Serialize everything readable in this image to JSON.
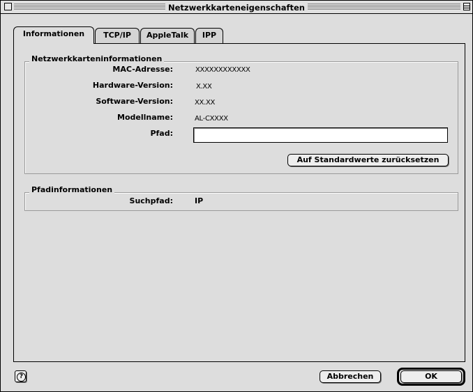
{
  "window": {
    "title": "Netzwerkkarteneigenschaften"
  },
  "tabs": [
    {
      "label": "Informationen",
      "active": true
    },
    {
      "label": "TCP/IP",
      "active": false
    },
    {
      "label": "AppleTalk",
      "active": false
    },
    {
      "label": "IPP",
      "active": false
    }
  ],
  "network_info": {
    "group_label": "Netzwerkkarteninformationen",
    "mac_label": "MAC-Adresse:",
    "mac_value": "XXXXXXXXXXXX",
    "hardware_label": "Hardware-Version:",
    "hardware_value": "X.XX",
    "software_label": "Software-Version:",
    "software_value": "XX.XX",
    "model_label": "Modellname:",
    "model_value": "AL-CXXXX",
    "path_label": "Pfad:",
    "path_value": "",
    "reset_button": "Auf Standardwerte zurücksetzen"
  },
  "path_info": {
    "group_label": "Pfadinformationen",
    "search_path_label": "Suchpfad:",
    "search_path_value": "IP"
  },
  "footer": {
    "help_icon": "?",
    "cancel_button": "Abbrechen",
    "ok_button": "OK"
  }
}
